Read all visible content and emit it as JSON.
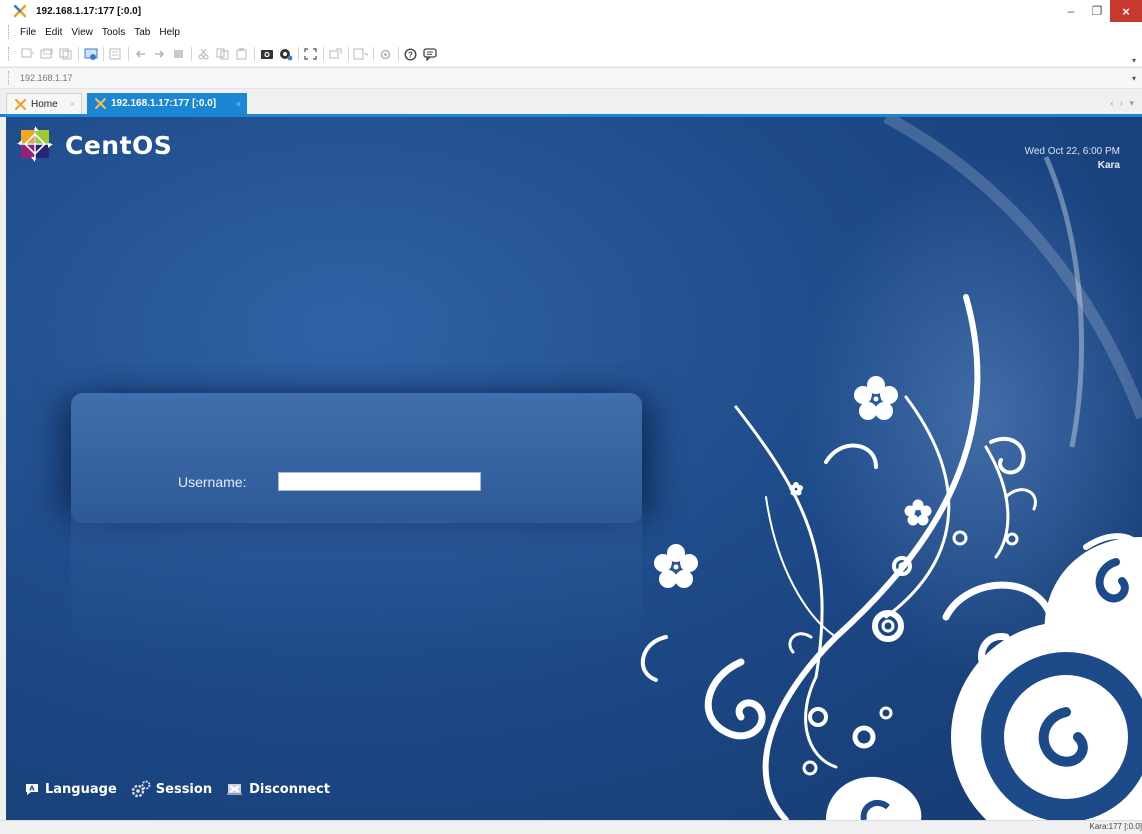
{
  "window": {
    "title": "192.168.1.17:177 [:0.0]",
    "minimize": "–",
    "maximize": "❐",
    "close": "×"
  },
  "menu": {
    "items": [
      "File",
      "Edit",
      "View",
      "Tools",
      "Tab",
      "Help"
    ]
  },
  "toolbar": {
    "overflow": "▾"
  },
  "address": {
    "value": "192.168.1.17",
    "overflow": "▾"
  },
  "tabs": [
    {
      "label": "Home",
      "close": "×"
    },
    {
      "label": "192.168.1.17:177 [:0.0]",
      "close": "×"
    }
  ],
  "tab_nav": "‹ › ▾",
  "remote": {
    "brand": "CentOS",
    "date": "Wed Oct 22,  6:00 PM",
    "host": "Kara",
    "username_label": "Username:",
    "username_value": "",
    "actions": [
      {
        "label": "Language",
        "icon": "language-icon"
      },
      {
        "label": "Session",
        "icon": "session-icon"
      },
      {
        "label": "Disconnect",
        "icon": "disconnect-icon"
      }
    ]
  },
  "status": {
    "text": "Kara:177 [:0.0]"
  },
  "colors": {
    "accent": "#1b86d4",
    "desktop": "#1e4b8a",
    "close": "#c7382e"
  }
}
